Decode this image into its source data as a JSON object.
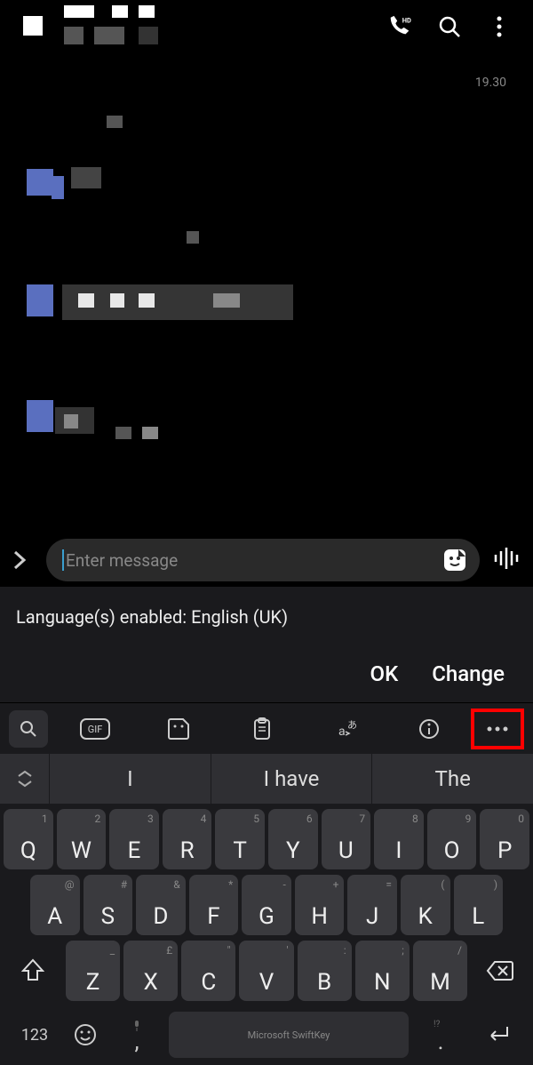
{
  "topbar": {
    "timestamp": "19.30"
  },
  "input": {
    "placeholder": "Enter message"
  },
  "lang_notice": {
    "text": "Language(s) enabled: English (UK)",
    "ok": "OK",
    "change": "Change"
  },
  "toolbar": {
    "gif": "GIF"
  },
  "suggestions": {
    "s1": "I",
    "s2": "I have",
    "s3": "The"
  },
  "keys": {
    "r1": [
      {
        "m": "Q",
        "a": "1"
      },
      {
        "m": "W",
        "a": "2"
      },
      {
        "m": "E",
        "a": "3"
      },
      {
        "m": "R",
        "a": "4"
      },
      {
        "m": "T",
        "a": "5"
      },
      {
        "m": "Y",
        "a": "6"
      },
      {
        "m": "U",
        "a": "7"
      },
      {
        "m": "I",
        "a": "8"
      },
      {
        "m": "O",
        "a": "9"
      },
      {
        "m": "P",
        "a": "0"
      }
    ],
    "r2": [
      {
        "m": "A",
        "a": "@"
      },
      {
        "m": "S",
        "a": "#"
      },
      {
        "m": "D",
        "a": "&"
      },
      {
        "m": "F",
        "a": "*"
      },
      {
        "m": "G",
        "a": "-"
      },
      {
        "m": "H",
        "a": "+"
      },
      {
        "m": "J",
        "a": "="
      },
      {
        "m": "K",
        "a": "("
      },
      {
        "m": "L",
        "a": ")"
      }
    ],
    "r3": [
      {
        "m": "Z",
        "a": "_"
      },
      {
        "m": "X",
        "a": "£"
      },
      {
        "m": "C",
        "a": "\""
      },
      {
        "m": "V",
        "a": "'"
      },
      {
        "m": "B",
        "a": ":"
      },
      {
        "m": "N",
        "a": ";"
      },
      {
        "m": "M",
        "a": "/"
      }
    ]
  },
  "bottom": {
    "num": "123",
    "comma": ",",
    "space_brand": "Microsoft SwiftKey",
    "dot": ".",
    "dot_alt": "!?"
  }
}
